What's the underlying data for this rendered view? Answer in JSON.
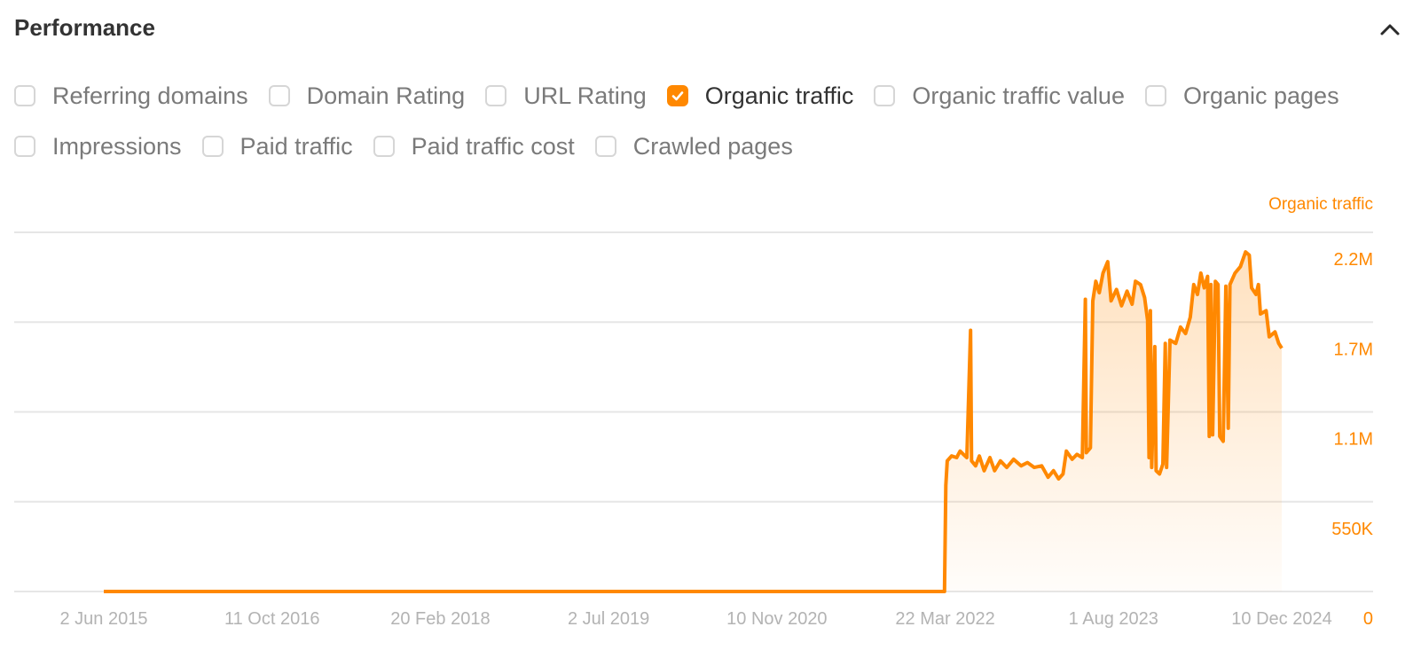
{
  "header": {
    "title": "Performance",
    "collapse_icon": "chevron-up-icon"
  },
  "filters": {
    "rows": [
      [
        {
          "label": "Referring domains",
          "checked": false
        },
        {
          "label": "Domain Rating",
          "checked": false
        },
        {
          "label": "URL Rating",
          "checked": false
        },
        {
          "label": "Organic traffic",
          "checked": true
        },
        {
          "label": "Organic traffic value",
          "checked": false
        },
        {
          "label": "Organic pages",
          "checked": false
        }
      ],
      [
        {
          "label": "Impressions",
          "checked": false
        },
        {
          "label": "Paid traffic",
          "checked": false
        },
        {
          "label": "Paid traffic cost",
          "checked": false
        },
        {
          "label": "Crawled pages",
          "checked": false
        }
      ]
    ]
  },
  "colors": {
    "accent": "#ff8800",
    "grid": "#e6e6e6",
    "tick_text": "#b3b3b3",
    "axis_text": "#ff8800"
  },
  "chart_data": {
    "type": "area",
    "title": "",
    "series_label": "Organic traffic",
    "xlabel": "",
    "ylabel": "Organic traffic",
    "y_axis_position": "right",
    "ylim": [
      0,
      2200000
    ],
    "y_ticks": [
      {
        "value": 0,
        "label": "0"
      },
      {
        "value": 550000,
        "label": "550K"
      },
      {
        "value": 1100000,
        "label": "1.1M"
      },
      {
        "value": 1650000,
        "label": "1.7M"
      },
      {
        "value": 2200000,
        "label": "2.2M"
      }
    ],
    "x_ticks": [
      "2 Jun 2015",
      "11 Oct 2016",
      "20 Feb 2018",
      "2 Jul 2019",
      "10 Nov 2020",
      "22 Mar 2022",
      "1 Aug 2023",
      "10 Dec 2024"
    ],
    "x_tick_dates": [
      "2015-06-02",
      "2016-10-11",
      "2018-02-20",
      "2019-07-02",
      "2020-11-10",
      "2022-03-22",
      "2023-08-01",
      "2024-12-10"
    ],
    "grid": true,
    "series": [
      {
        "name": "Organic traffic",
        "points": [
          [
            "2015-06-02",
            0
          ],
          [
            "2022-03-20",
            0
          ],
          [
            "2022-03-24",
            650000
          ],
          [
            "2022-03-28",
            800000
          ],
          [
            "2022-04-10",
            830000
          ],
          [
            "2022-04-25",
            820000
          ],
          [
            "2022-05-05",
            860000
          ],
          [
            "2022-05-15",
            840000
          ],
          [
            "2022-05-25",
            820000
          ],
          [
            "2022-06-05",
            1600000
          ],
          [
            "2022-06-08",
            800000
          ],
          [
            "2022-06-20",
            770000
          ],
          [
            "2022-07-01",
            830000
          ],
          [
            "2022-07-15",
            740000
          ],
          [
            "2022-08-01",
            820000
          ],
          [
            "2022-08-15",
            740000
          ],
          [
            "2022-09-01",
            800000
          ],
          [
            "2022-09-20",
            760000
          ],
          [
            "2022-10-10",
            810000
          ],
          [
            "2022-11-01",
            770000
          ],
          [
            "2022-11-20",
            790000
          ],
          [
            "2022-12-10",
            760000
          ],
          [
            "2023-01-01",
            770000
          ],
          [
            "2023-01-20",
            700000
          ],
          [
            "2023-02-05",
            740000
          ],
          [
            "2023-02-20",
            690000
          ],
          [
            "2023-03-05",
            720000
          ],
          [
            "2023-03-15",
            860000
          ],
          [
            "2023-04-01",
            810000
          ],
          [
            "2023-04-15",
            840000
          ],
          [
            "2023-05-01",
            820000
          ],
          [
            "2023-05-10",
            1790000
          ],
          [
            "2023-05-13",
            850000
          ],
          [
            "2023-05-25",
            880000
          ],
          [
            "2023-06-01",
            1780000
          ],
          [
            "2023-06-10",
            1900000
          ],
          [
            "2023-06-20",
            1830000
          ],
          [
            "2023-07-01",
            1950000
          ],
          [
            "2023-07-15",
            2020000
          ],
          [
            "2023-07-25",
            1780000
          ],
          [
            "2023-08-10",
            1850000
          ],
          [
            "2023-08-25",
            1750000
          ],
          [
            "2023-09-10",
            1840000
          ],
          [
            "2023-09-25",
            1760000
          ],
          [
            "2023-10-05",
            1900000
          ],
          [
            "2023-10-20",
            1880000
          ],
          [
            "2023-11-01",
            1800000
          ],
          [
            "2023-11-10",
            1660000
          ],
          [
            "2023-11-14",
            820000
          ],
          [
            "2023-11-18",
            1720000
          ],
          [
            "2023-11-22",
            760000
          ],
          [
            "2023-12-01",
            1500000
          ],
          [
            "2023-12-05",
            740000
          ],
          [
            "2023-12-15",
            720000
          ],
          [
            "2023-12-25",
            780000
          ],
          [
            "2024-01-01",
            1520000
          ],
          [
            "2024-01-05",
            760000
          ],
          [
            "2024-01-15",
            1540000
          ],
          [
            "2024-02-01",
            1520000
          ],
          [
            "2024-02-15",
            1620000
          ],
          [
            "2024-03-01",
            1580000
          ],
          [
            "2024-03-15",
            1680000
          ],
          [
            "2024-03-25",
            1880000
          ],
          [
            "2024-04-05",
            1820000
          ],
          [
            "2024-04-15",
            1950000
          ],
          [
            "2024-04-25",
            1860000
          ],
          [
            "2024-05-05",
            1930000
          ],
          [
            "2024-05-10",
            950000
          ],
          [
            "2024-05-15",
            1880000
          ],
          [
            "2024-05-20",
            960000
          ],
          [
            "2024-05-28",
            1900000
          ],
          [
            "2024-06-05",
            1880000
          ],
          [
            "2024-06-10",
            950000
          ],
          [
            "2024-06-20",
            920000
          ],
          [
            "2024-06-28",
            1870000
          ],
          [
            "2024-07-05",
            1000000
          ],
          [
            "2024-07-10",
            1880000
          ],
          [
            "2024-07-25",
            1950000
          ],
          [
            "2024-08-10",
            1990000
          ],
          [
            "2024-08-25",
            2080000
          ],
          [
            "2024-09-05",
            2060000
          ],
          [
            "2024-09-12",
            1860000
          ],
          [
            "2024-09-25",
            1820000
          ],
          [
            "2024-10-02",
            1880000
          ],
          [
            "2024-10-08",
            1700000
          ],
          [
            "2024-10-25",
            1720000
          ],
          [
            "2024-11-03",
            1560000
          ],
          [
            "2024-11-20",
            1590000
          ],
          [
            "2024-12-01",
            1520000
          ],
          [
            "2024-12-10",
            1490000
          ]
        ]
      }
    ]
  }
}
